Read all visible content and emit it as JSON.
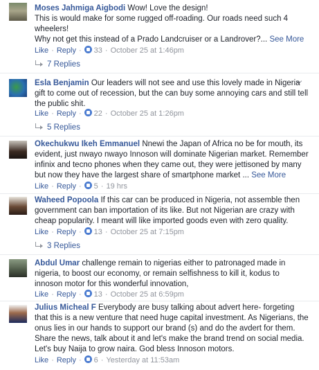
{
  "comments": [
    {
      "author": "Moses Jahmiga Aigbodi",
      "lines": [
        "Wow! Love the design!",
        "This is would make for some rugged off-roading. Our roads need such 4 wheelers!",
        "Why not get this instead of a Prado Landcruiser or a Landrover?..."
      ],
      "more": "See More",
      "like": "Like",
      "reply": "Reply",
      "reactions": "33",
      "time": "October 25 at 1:46pm",
      "replies": "7 Replies"
    },
    {
      "author": "Esla Benjamin",
      "text": "Our leaders will not see and use this lovely made in Nigeria gift to come out of recession, but the can buy some annoying cars and still tell the public shit.",
      "like": "Like",
      "reply": "Reply",
      "reactions": "22",
      "time": "October 25 at 1:26pm",
      "replies": "5 Replies"
    },
    {
      "author": "Okechukwu Ikeh Emmanuel",
      "text": "Nnewi the Japan of Africa no be for mouth, its evident, just nwayo nwayo Innoson will dominate Nigerian market. Remember infinix and tecno phones when they came out, they were jettisoned by many but now they have the largest share of smartphone market ...",
      "more": "See More",
      "like": "Like",
      "reply": "Reply",
      "reactions": "5",
      "time": "19 hrs"
    },
    {
      "author": "Waheed Popoola",
      "text": "If this car can be produced in Nigeria, not assemble then government can ban importation of its like. But not Nigerian are crazy with cheap popularity. I meant will like imported goods even with zero quality.",
      "like": "Like",
      "reply": "Reply",
      "reactions": "13",
      "time": "October 25 at 7:15pm",
      "replies": "3 Replies"
    },
    {
      "author": "Abdul Umar",
      "text": "challenge remain to nigerias either to patronaged made in nigeria, to boost our economy, or remain selfishness to kill it, kodus to innoson motor for this wonderful innovation,",
      "like": "Like",
      "reply": "Reply",
      "reactions": "13",
      "time": "October 25 at 6:59pm"
    },
    {
      "author": "Julius Micheal F",
      "text": "Everybody are busy talking about advert here- forgeting that this is a new venture that need huge capital investment. As Nigerians, the onus lies in our hands to support our brand (s) and do the avdert for them. Share the news, talk about it and let's make the brand trend on social media. Let's buy Naija to grow naira. God bless Innoson motors.",
      "like": "Like",
      "reply": "Reply",
      "reactions": "6",
      "time": "Yesterday at 11:53am"
    }
  ]
}
